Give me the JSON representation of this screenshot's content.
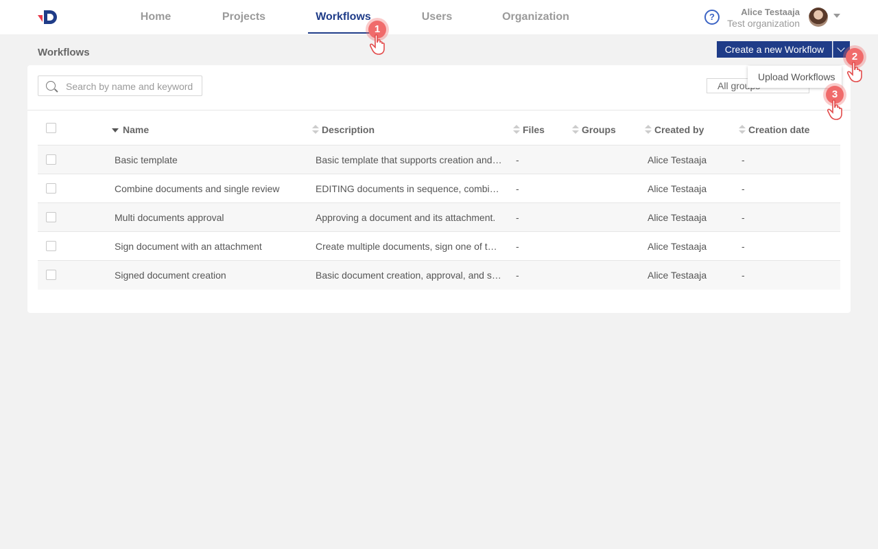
{
  "nav": {
    "items": [
      {
        "label": "Home",
        "active": false
      },
      {
        "label": "Projects",
        "active": false
      },
      {
        "label": "Workflows",
        "active": true
      },
      {
        "label": "Users",
        "active": false
      },
      {
        "label": "Organization",
        "active": false
      }
    ]
  },
  "user": {
    "name": "Alice Testaaja",
    "organization": "Test organization",
    "help_icon": "question-circle-icon"
  },
  "page": {
    "title": "Workflows",
    "create_button": "Create a new Workflow"
  },
  "dropdown": {
    "item": "Upload Workflows"
  },
  "search": {
    "placeholder": "Search by name and keyword"
  },
  "groups_filter": {
    "value": "All groups"
  },
  "table": {
    "headers": {
      "name": "Name",
      "description": "Description",
      "files": "Files",
      "groups": "Groups",
      "created_by": "Created by",
      "creation_date": "Creation date"
    },
    "rows": [
      {
        "name": "Basic template",
        "description": "Basic template that supports creation and d...",
        "files": "-",
        "groups": "",
        "created_by": "Alice Testaaja",
        "creation_date": "-"
      },
      {
        "name": "Combine documents and single review",
        "description": "EDITING documents in sequence, combine t...",
        "files": "-",
        "groups": "",
        "created_by": "Alice Testaaja",
        "creation_date": "-"
      },
      {
        "name": "Multi documents approval",
        "description": "Approving a document and its attachment.",
        "files": "-",
        "groups": "",
        "created_by": "Alice Testaaja",
        "creation_date": "-"
      },
      {
        "name": "Sign document with an attachment",
        "description": "Create multiple documents, sign one of the...",
        "files": "-",
        "groups": "",
        "created_by": "Alice Testaaja",
        "creation_date": "-"
      },
      {
        "name": "Signed document creation",
        "description": "Basic document creation, approval, and sign...",
        "files": "-",
        "groups": "",
        "created_by": "Alice Testaaja",
        "creation_date": "-"
      }
    ]
  },
  "steps": [
    "1",
    "2",
    "3"
  ],
  "colors": {
    "brand": "#1f3c88",
    "marker": "#f06b6b",
    "logo_accent": "#e8394a"
  }
}
